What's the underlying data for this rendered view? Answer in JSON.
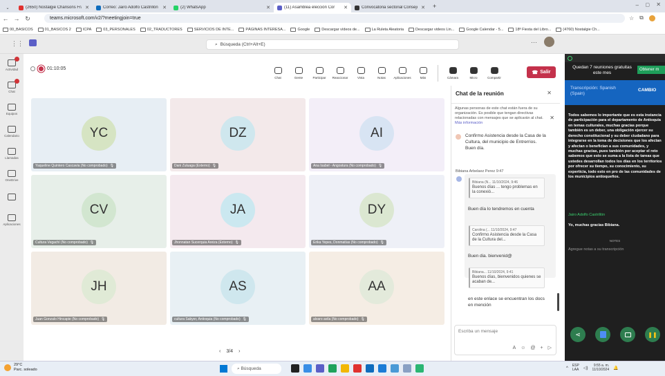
{
  "browser": {
    "tabs": [
      {
        "label": "(2650) Nostalgie Chansons Fra:",
        "color": "#e0312f",
        "active": false
      },
      {
        "label": "Correo: Jairo Adolfo Castrillón -",
        "color": "#0f6cbd",
        "active": false
      },
      {
        "label": "(2) WhatsApp",
        "color": "#25d366",
        "active": false
      },
      {
        "label": "(11) Asamblea elección Cor",
        "color": "#5b5fc7",
        "active": true
      },
      {
        "label": "Convocatoria sectorial Consejo",
        "color": "#333333",
        "active": false
      }
    ],
    "url": "teams.microsoft.com/v2/?meetingjoin=true",
    "bookmarks": [
      "00_BASICOS",
      "01_BASICOS 2",
      "ICPA",
      "03_PERSONALES",
      "02_TRADUCTORES",
      "SERVICIOS DE INTE...",
      "PÁGINAS INTERESA...",
      "Google",
      "Descargar vídeos de...",
      "La Ruleta Aleatoria",
      "Descargar videos Lin...",
      "Google Calendar - 5...",
      "18ª Fiesta del Libro...",
      "(4760) Nostalgie Ch..."
    ]
  },
  "teams": {
    "search_placeholder": "Búsqueda (Ctrl+Alt+E)",
    "rail": [
      "Actividad",
      "Chat",
      "Equipos",
      "Calendario",
      "Llamadas",
      "OneDrive",
      "",
      "Aplicaciones"
    ],
    "timer": "01:10:05",
    "toolbar": [
      "Chat",
      "Gente",
      "Participar",
      "Reaccionar",
      "Vista",
      "Notas",
      "Aplicaciones",
      "Más",
      "Cámara",
      "Micro",
      "Compartir"
    ],
    "leave": "Salir",
    "tiles": [
      {
        "initials": "YC",
        "name": "Yaqueline Quintero Cascavia (No comprobado)",
        "bg": "#e7eef4",
        "av": "#d6e4c3"
      },
      {
        "initials": "DZ",
        "name": "Dani Zuluaga (Externo)",
        "bg": "#f3e9ea",
        "av": "#cfe7ee"
      },
      {
        "initials": "AI",
        "name": "Ana Isabel - Angostura (No comprobado)",
        "bg": "#f3eef8",
        "av": "#d8e4f3"
      },
      {
        "initials": "CV",
        "name": "Cultura Vegachí (No comprobado)",
        "bg": "#e7efe9",
        "av": "#d2e6d0"
      },
      {
        "initials": "JA",
        "name": "Jhonnatan Sucerquia Areiza (Externo)",
        "bg": "#f4e9ee",
        "av": "#cbe8f0"
      },
      {
        "initials": "DY",
        "name": "Erika Yepes, Donmatías (No comprobado)",
        "bg": "#eef0f7",
        "av": "#dbe7d1"
      },
      {
        "initials": "JH",
        "name": "Juan Gonzalo Hincapie (No comprobado)",
        "bg": "#f2ebe4",
        "av": "#e0ead6"
      },
      {
        "initials": "AS",
        "name": "cultura Sabyer, Antioquia (No comprobado)",
        "bg": "#e8f0f4",
        "av": "#cfe7ee"
      },
      {
        "initials": "AA",
        "name": "alvaro avila (No comprobado)",
        "bg": "#f5ede4",
        "av": "#e3eadb"
      }
    ],
    "pager": "3/4"
  },
  "chat": {
    "title": "Chat de la reunión",
    "notice": "Algunas personas de este chat están fuera de su organización. Es posible que tengan directivas relacionadas con mensajes que se aplicarán al chat.",
    "notice_link": "Más información",
    "msg1": "Confirmo Asistencia desde la Casa de la Cultura, del municipio de Entrerrios. Buen día.",
    "sender2": "Bibiana Arbelaez Perez  9:47",
    "q1_head": "Bibiana (N...  11/10/2024, 9:46",
    "q1_text": "Buenos días ... tengo problemas en la conexió...",
    "msg2": "Buen día lo tendremos en cuenta",
    "q2_head": "Carolina (...  11/10/2024, 9:47",
    "q2_text": "Confirmo Asistencia desde la Casa de la Cultura  del...",
    "msg3": "Buen dia. bienvenid@",
    "q3_head": "Bibiana...  11/10/2024, 9:41",
    "q3_text": "Buenos días, bienvenidos quienes se acaban de...",
    "msg4": "en este enlace se encuentran los docs en mención",
    "input_placeholder": "Escriba un mensaje"
  },
  "transcript": {
    "remaining": "Quedan 7 reuniones gratuitas este mes",
    "get_more": "Obtener m",
    "lang_label": "Transcripción: Spanish (Spain)",
    "change": "CAMBIO",
    "body": "Todos sabemos lo importante que es esta instancia de participación para el departamento de Antioquia en temas culturales, muchas gracias porque también es un deber, una obligación ejercer su derecho constitucional y su deber ciudadano para integrarse en la toma de decisiones que los afectan y afectan o benefician a sus comunidades, y muchas gracias, pues también por aceptar el reto sabemos que esto se suma a la lista de tareas que ustedes desarrollan todos los días en los territorios por ofrecer su tiempo, su conocimiento, su experticia, todo esto en pro de las comunidades de los municipios antioqueños.",
    "speaker": "Jairo Adolfo Castrillón",
    "reply": "Yo, muchas gracias Bibiana.",
    "notes": "NOTES",
    "notes_placeholder": "Agregue notas a su transcripción"
  },
  "taskbar": {
    "weather": "29°C",
    "weather_sub": "Parc. soleado",
    "search": "Búsqueda",
    "lang": "ESP",
    "lang_sub": "LAA",
    "time": "9:55 a. m.",
    "date": "11/10/2024"
  }
}
